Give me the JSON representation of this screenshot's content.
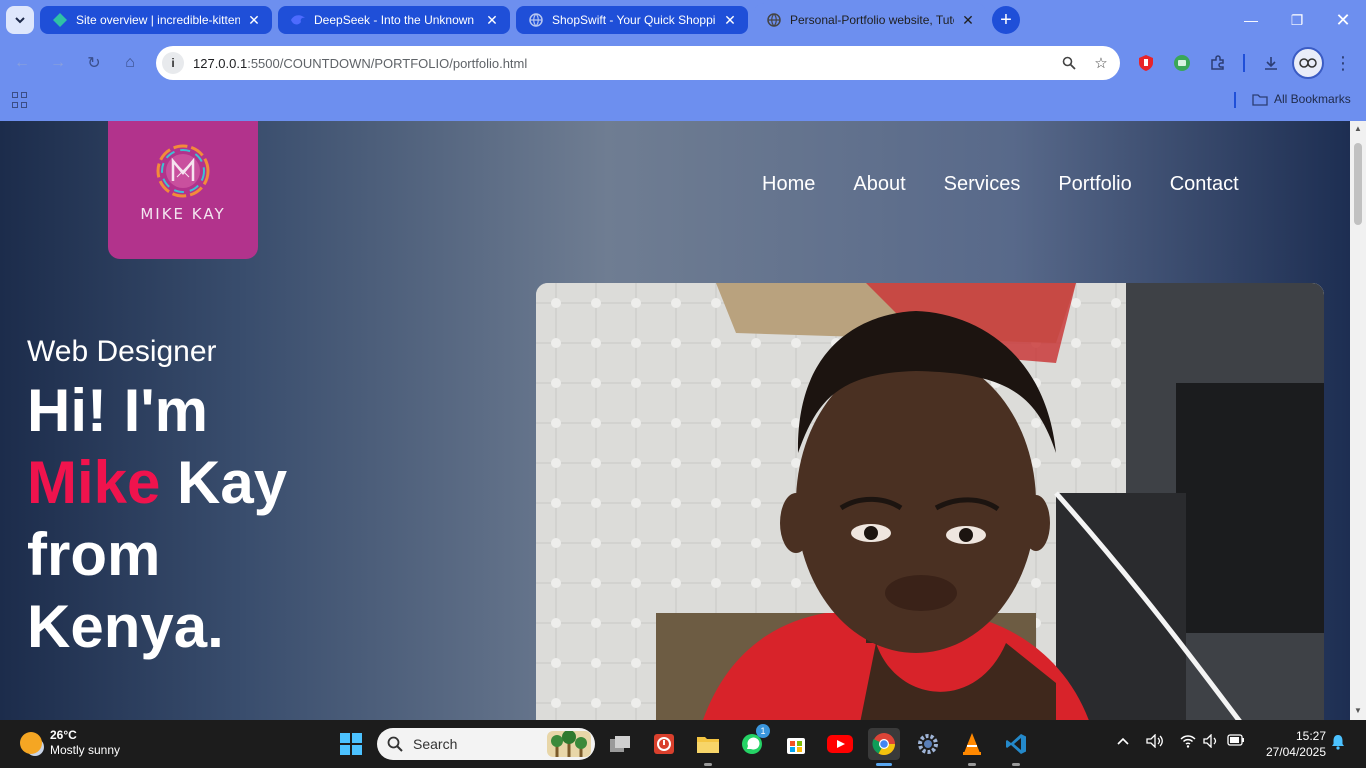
{
  "browser": {
    "tabs": [
      {
        "title": "Site overview | incredible-kitten",
        "favicon": "netlify-icon",
        "active": false
      },
      {
        "title": "DeepSeek - Into the Unknown",
        "favicon": "deepseek-icon",
        "active": false
      },
      {
        "title": "ShopSwift - Your Quick Shopping",
        "favicon": "globe-icon",
        "active": false
      },
      {
        "title": "Personal-Portfolio website, Tutorial",
        "favicon": "globe-icon",
        "active": true
      }
    ],
    "url_host": "127.0.0.1",
    "url_path": ":5500/COUNTDOWN/PORTFOLIO/portfolio.html",
    "bookmarks_label": "All Bookmarks"
  },
  "page": {
    "logo_text": "MIKE KAY",
    "nav": [
      "Home",
      "About",
      "Services",
      "Portfolio",
      "Contact"
    ],
    "hero": {
      "subtitle": "Web Designer",
      "line1": "Hi! I'm",
      "name_accent": "Mike",
      "name_rest": " Kay",
      "line3": "from",
      "line4": "Kenya."
    },
    "colors": {
      "accent": "#f0134d",
      "logo_bg": "#b2338c"
    }
  },
  "taskbar": {
    "weather_temp": "26°C",
    "weather_desc": "Mostly sunny",
    "search_placeholder": "Search",
    "whatsapp_badge": "1",
    "time": "15:27",
    "date": "27/04/2025"
  }
}
